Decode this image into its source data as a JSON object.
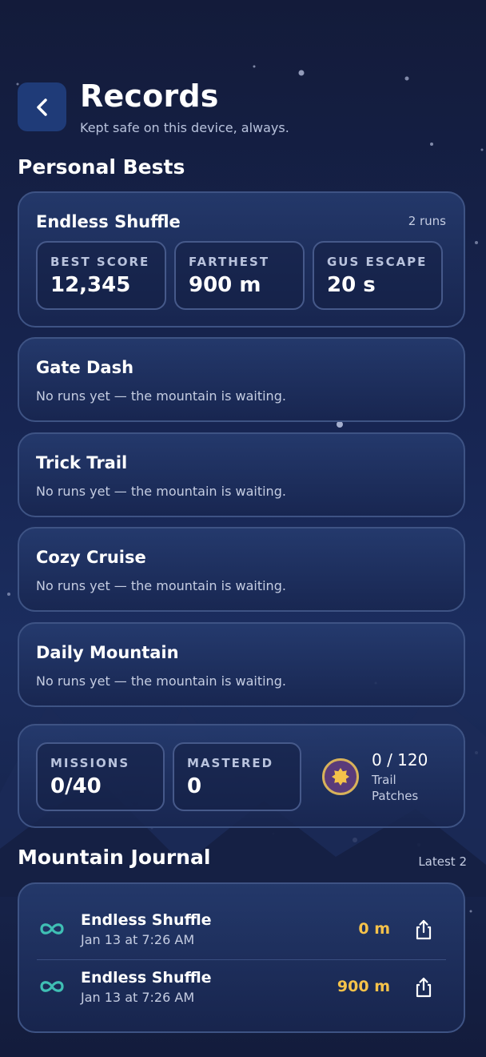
{
  "header": {
    "title": "Records",
    "subtitle": "Kept safe on this device, always."
  },
  "personal_bests": {
    "heading": "Personal Bests",
    "featured": {
      "title": "Endless Shuffle",
      "runs": "2 runs",
      "stats": [
        {
          "label": "BEST SCORE",
          "value": "12,345"
        },
        {
          "label": "FARTHEST",
          "value": "900 m"
        },
        {
          "label": "GUS ESCAPE",
          "value": "20 s"
        }
      ]
    },
    "modes": [
      {
        "title": "Gate Dash",
        "status": "No runs yet — the mountain is waiting."
      },
      {
        "title": "Trick Trail",
        "status": "No runs yet — the mountain is waiting."
      },
      {
        "title": "Cozy Cruise",
        "status": "No runs yet — the mountain is waiting."
      },
      {
        "title": "Daily Mountain",
        "status": "No runs yet — the mountain is waiting."
      }
    ]
  },
  "progress": {
    "missions": {
      "label": "MISSIONS",
      "value": "0/40"
    },
    "mastered": {
      "label": "MASTERED",
      "value": "0"
    },
    "patches": {
      "count": "0 / 120",
      "label_line1": "Trail",
      "label_line2": "Patches",
      "icon": "badge-icon"
    }
  },
  "journal": {
    "heading": "Mountain Journal",
    "latest": "Latest 2",
    "entries": [
      {
        "mode": "Endless Shuffle",
        "date": "Jan 13 at 7:26 AM",
        "distance": "0 m",
        "icon": "infinity-icon"
      },
      {
        "mode": "Endless Shuffle",
        "date": "Jan 13 at 7:26 AM",
        "distance": "900 m",
        "icon": "infinity-icon"
      }
    ]
  },
  "colors": {
    "accent": "#f5c24a",
    "teal": "#3fbfb4",
    "card_border": "#3e5384",
    "background": "#172552"
  }
}
